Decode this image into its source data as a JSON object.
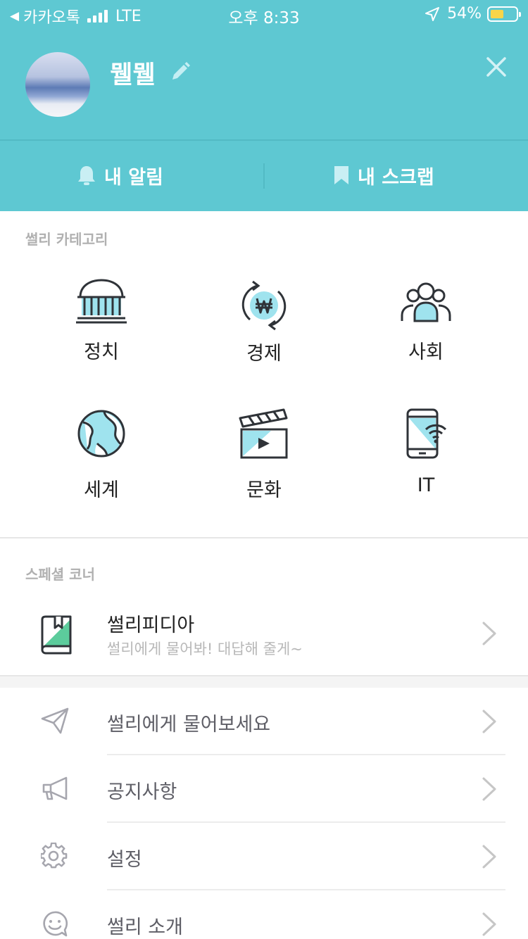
{
  "status": {
    "back_label": "◀",
    "carrier": "카카오톡",
    "network": "LTE",
    "time": "오후 8:33",
    "battery": "54%",
    "battery_level": 0.54
  },
  "profile": {
    "name": "뭴뭴"
  },
  "header_buttons": {
    "alarm": "내 알림",
    "scrap": "내 스크랩"
  },
  "category_section": {
    "title": "썰리 카테고리",
    "items": [
      {
        "label": "정치",
        "icon": "parliament-icon"
      },
      {
        "label": "경제",
        "icon": "won-exchange-icon"
      },
      {
        "label": "사회",
        "icon": "people-icon"
      },
      {
        "label": "세계",
        "icon": "globe-icon"
      },
      {
        "label": "문화",
        "icon": "clapperboard-icon"
      },
      {
        "label": "IT",
        "icon": "smartphone-wifi-icon"
      }
    ]
  },
  "special_section": {
    "title": "스페셜 코너",
    "wiki": {
      "title": "썰리피디아",
      "subtitle": "썰리에게 물어봐! 대답해 줄게~"
    }
  },
  "menu": [
    {
      "label": "썰리에게 물어보세요",
      "icon": "paper-plane-icon"
    },
    {
      "label": "공지사항",
      "icon": "megaphone-icon"
    },
    {
      "label": "설정",
      "icon": "gear-icon"
    },
    {
      "label": "썰리 소개",
      "icon": "smiley-bubble-icon"
    }
  ],
  "colors": {
    "header": "#5ec8d2",
    "accent": "#9fe3ee",
    "icon_stroke": "#2f3338",
    "book_green": "#5ccc9c",
    "battery_fill": "#f7d54a"
  }
}
